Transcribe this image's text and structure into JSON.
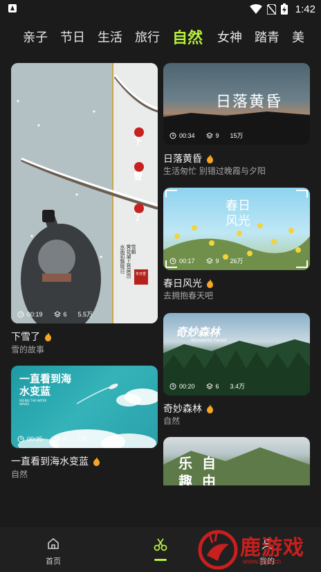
{
  "status_bar": {
    "time": "1:42",
    "icons": [
      "android-notification-icon",
      "wifi-icon",
      "no-sim-icon",
      "battery-charging-icon"
    ]
  },
  "tabs": [
    {
      "label": "亲子",
      "active": false
    },
    {
      "label": "节日",
      "active": false
    },
    {
      "label": "生活",
      "active": false
    },
    {
      "label": "旅行",
      "active": false
    },
    {
      "label": "自然",
      "active": true
    },
    {
      "label": "女神",
      "active": false
    },
    {
      "label": "踏青",
      "active": false
    },
    {
      "label": "美",
      "active": false
    }
  ],
  "colors": {
    "background": "#1b1b1b",
    "accent": "#b7ef3a",
    "hot_flame": "#f5a623"
  },
  "cards": {
    "snow": {
      "title": "下雪了",
      "subtitle": "雪的故事",
      "duration": "00:19",
      "layers": "6",
      "uses": "5.5万",
      "overlay_chars": [
        "下",
        "雪",
        "了"
      ],
      "poem_lines": [
        "水面初飘晓日",
        "霁花凝上苍居岂",
        "雪朝"
      ],
      "seal_text": "冬日雪"
    },
    "sunset": {
      "title": "日落黄昏",
      "subtitle": "生活匆忙 别错过晚霞与夕阳",
      "duration": "00:34",
      "layers": "9",
      "uses": "15万",
      "overlay_title": "日落黄昏"
    },
    "spring": {
      "title": "春日风光",
      "subtitle": "去拥抱春天吧",
      "duration": "00:17",
      "layers": "9",
      "uses": "26万",
      "overlay_title": "春日风光"
    },
    "sea": {
      "title": "一直看到海水变蓝",
      "subtitle": "自然",
      "duration": "00:35",
      "layers": "6",
      "uses": "1万",
      "overlay_title": "一直看到海水变蓝",
      "overlay_small": "SEEING THE WATER WAVES"
    },
    "forest": {
      "title": "奇妙森林",
      "subtitle": "自然",
      "duration": "00:20",
      "layers": "6",
      "uses": "3.4万",
      "overlay_title": "奇妙森林",
      "overlay_small": "Wonderful Forest"
    },
    "fun": {
      "overlay_title": "乐自",
      "overlay_title2": "趣由"
    }
  },
  "nav": {
    "items": [
      {
        "label": "首页",
        "icon": "home-icon"
      },
      {
        "label": "",
        "icon": "scissors-icon",
        "active": true
      },
      {
        "label": "我的",
        "icon": "profile-icon"
      }
    ]
  },
  "watermark": {
    "text": "鹿游戏",
    "url": "www.luyx.cn"
  }
}
